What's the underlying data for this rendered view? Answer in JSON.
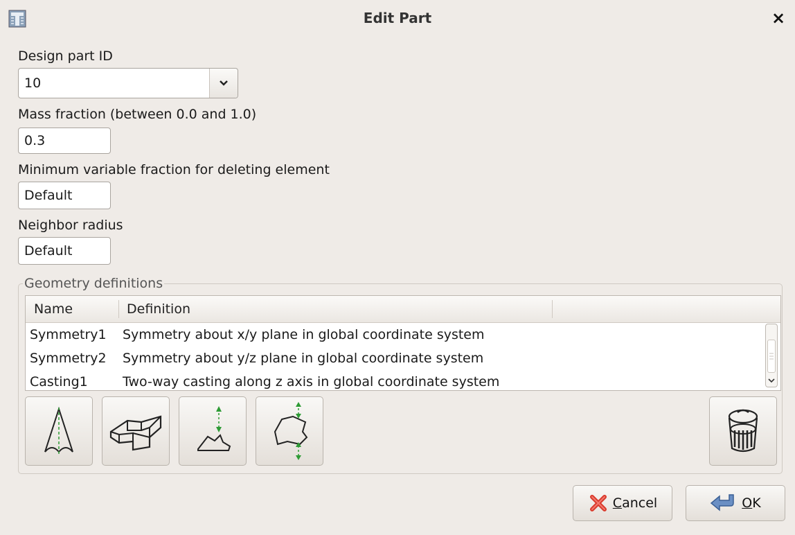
{
  "window": {
    "title": "Edit Part",
    "close_glyph": "×",
    "app_icon": "app-icon"
  },
  "form": {
    "design_part_id_label": "Design part ID",
    "design_part_id_value": "10",
    "mass_fraction_label": "Mass fraction (between 0.0 and 1.0)",
    "mass_fraction_value": "0.3",
    "min_var_fraction_label": "Minimum variable fraction for deleting element",
    "min_var_fraction_value": "Default",
    "neighbor_radius_label": "Neighbor radius",
    "neighbor_radius_value": "Default"
  },
  "geometry": {
    "group_label": "Geometry definitions",
    "columns": [
      "Name",
      "Definition"
    ],
    "rows": [
      {
        "name": "Symmetry1",
        "definition": "Symmetry about x/y plane in global coordinate system"
      },
      {
        "name": "Symmetry2",
        "definition": "Symmetry about y/z plane in global coordinate system"
      },
      {
        "name": "Casting1",
        "definition": "Two-way casting along z axis in global coordinate system"
      }
    ],
    "tools": [
      "symmetry-icon",
      "extrusion-icon",
      "one-way-casting-icon",
      "two-way-casting-icon",
      "trash-icon"
    ]
  },
  "buttons": {
    "cancel_first": "C",
    "cancel_rest": "ancel",
    "ok_first": "O",
    "ok_rest": "K"
  },
  "colors": {
    "background": "#efebe7",
    "cancel_icon": "#d9392b",
    "ok_icon": "#6a8fc4",
    "arrow_green": "#2e9b35"
  }
}
